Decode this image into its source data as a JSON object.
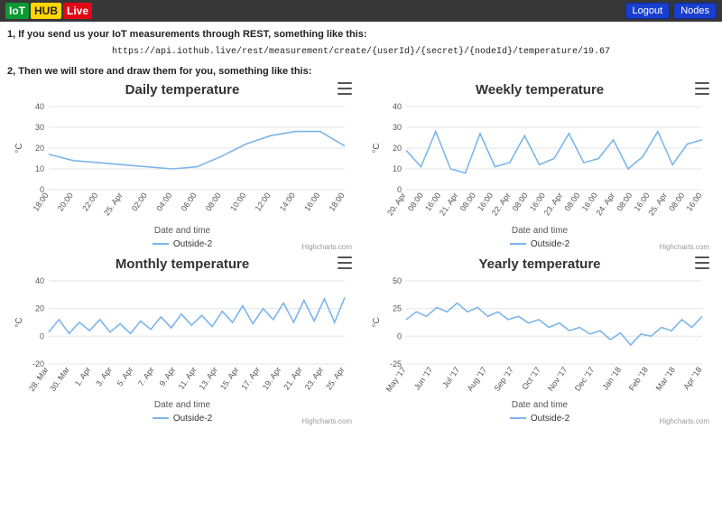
{
  "header": {
    "logo": {
      "iot": "IoT",
      "hub": "HUB",
      "live": "Live"
    },
    "nav": {
      "logout": "Logout",
      "nodes": "Nodes"
    }
  },
  "intro": {
    "line1": "1, If you send us your IoT measurements through REST, something like this:",
    "api_url": "https://api.iothub.live/rest/measurement/create/{userId}/{secret}/{nodeId}/temperature/19.67",
    "line2": "2, Then we will store and draw them for you, something like this:"
  },
  "common": {
    "series_name": "Outside-2",
    "xlabel": "Date and time",
    "ylabel": "°C",
    "credits": "Highcharts.com"
  },
  "chart_data": [
    {
      "id": "daily",
      "type": "line",
      "title": "Daily temperature",
      "xlabel": "Date and time",
      "ylabel": "°C",
      "ylim": [
        0,
        40
      ],
      "yticks": [
        0,
        10,
        20,
        30,
        40
      ],
      "categories": [
        "18:00",
        "20:00",
        "22:00",
        "25. Apr",
        "02:00",
        "04:00",
        "06:00",
        "08:00",
        "10:00",
        "12:00",
        "14:00",
        "16:00",
        "18:00"
      ],
      "series": [
        {
          "name": "Outside-2",
          "values": [
            17,
            14,
            13,
            12,
            11,
            10,
            11,
            16,
            22,
            26,
            28,
            28,
            21
          ]
        }
      ]
    },
    {
      "id": "weekly",
      "type": "line",
      "title": "Weekly temperature",
      "xlabel": "Date and time",
      "ylabel": "°C",
      "ylim": [
        0,
        40
      ],
      "yticks": [
        0,
        10,
        20,
        30,
        40
      ],
      "categories": [
        "20. Apr",
        "08:00",
        "16:00",
        "21. Apr",
        "08:00",
        "16:00",
        "22. Apr",
        "08:00",
        "16:00",
        "23. Apr",
        "08:00",
        "16:00",
        "24. Apr",
        "08:00",
        "16:00",
        "25. Apr",
        "08:00",
        "16:00"
      ],
      "series": [
        {
          "name": "Outside-2",
          "values": [
            19,
            11,
            28,
            10,
            8,
            27,
            11,
            13,
            26,
            12,
            15,
            27,
            13,
            15,
            24,
            10,
            16,
            28,
            12,
            22,
            24
          ]
        }
      ]
    },
    {
      "id": "monthly",
      "type": "line",
      "title": "Monthly temperature",
      "xlabel": "Date and time",
      "ylabel": "°C",
      "ylim": [
        -20,
        40
      ],
      "yticks": [
        -20,
        0,
        20,
        40
      ],
      "categories": [
        "28. Mar",
        "30. Mar",
        "1. Apr",
        "3. Apr",
        "5. Apr",
        "7. Apr",
        "9. Apr",
        "11. Apr",
        "13. Apr",
        "15. Apr",
        "17. Apr",
        "19. Apr",
        "21. Apr",
        "23. Apr",
        "25. Apr"
      ],
      "series": [
        {
          "name": "Outside-2",
          "values": [
            3,
            12,
            2,
            10,
            4,
            12,
            3,
            9,
            2,
            11,
            5,
            14,
            6,
            16,
            8,
            15,
            7,
            18,
            10,
            22,
            9,
            20,
            12,
            24,
            10,
            26,
            11,
            27,
            10,
            28
          ]
        }
      ]
    },
    {
      "id": "yearly",
      "type": "line",
      "title": "Yearly temperature",
      "xlabel": "Date and time",
      "ylabel": "°C",
      "ylim": [
        -25,
        50
      ],
      "yticks": [
        -25,
        0,
        25,
        50
      ],
      "categories": [
        "May '17",
        "Jun '17",
        "Jul '17",
        "Aug '17",
        "Sep '17",
        "Oct '17",
        "Nov '17",
        "Dec '17",
        "Jan '18",
        "Feb '18",
        "Mar '18",
        "Apr '18"
      ],
      "series": [
        {
          "name": "Outside-2",
          "values": [
            15,
            22,
            18,
            26,
            22,
            30,
            22,
            26,
            18,
            22,
            15,
            18,
            12,
            15,
            8,
            12,
            5,
            8,
            2,
            5,
            -3,
            3,
            -8,
            2,
            0,
            8,
            5,
            15,
            8,
            18
          ]
        }
      ]
    }
  ]
}
